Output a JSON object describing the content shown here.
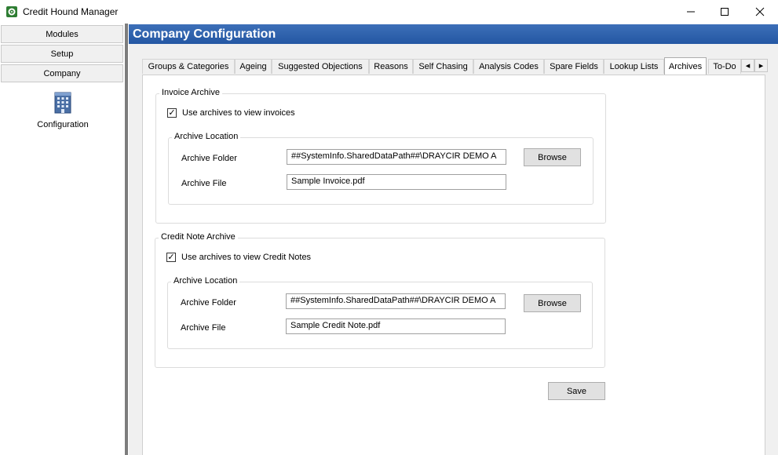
{
  "window": {
    "title": "Credit Hound Manager",
    "minimize_glyph": "—",
    "maximize_glyph": "☐",
    "close_glyph": "✕"
  },
  "nav": {
    "modules": "Modules",
    "setup": "Setup",
    "company": "Company",
    "configuration": "Configuration"
  },
  "header": {
    "title": "Company Configuration"
  },
  "tabs": [
    {
      "label": "Groups & Categories"
    },
    {
      "label": "Ageing"
    },
    {
      "label": "Suggested Objections"
    },
    {
      "label": "Reasons"
    },
    {
      "label": "Self Chasing"
    },
    {
      "label": "Analysis Codes"
    },
    {
      "label": "Spare Fields"
    },
    {
      "label": "Lookup Lists"
    },
    {
      "label": "Archives",
      "selected": true
    },
    {
      "label": "To-Do"
    }
  ],
  "tab_scroll": {
    "left": "◂",
    "right": "▸"
  },
  "invoice_archive": {
    "legend": "Invoice Archive",
    "checkbox_checked": true,
    "checkbox_label": "Use archives to view invoices",
    "location_legend": "Archive Location",
    "folder_label": "Archive Folder",
    "folder_value": "##SystemInfo.SharedDataPath##\\DRAYCIR DEMO A",
    "file_label": "Archive File",
    "file_value": "Sample Invoice.pdf",
    "browse_label": "Browse"
  },
  "credit_note_archive": {
    "legend": "Credit Note Archive",
    "checkbox_checked": true,
    "checkbox_label": "Use archives to view Credit Notes",
    "location_legend": "Archive Location",
    "folder_label": "Archive Folder",
    "folder_value": "##SystemInfo.SharedDataPath##\\DRAYCIR DEMO A",
    "file_label": "Archive File",
    "file_value": "Sample Credit Note.pdf",
    "browse_label": "Browse"
  },
  "save_label": "Save",
  "check_glyph": "✓"
}
